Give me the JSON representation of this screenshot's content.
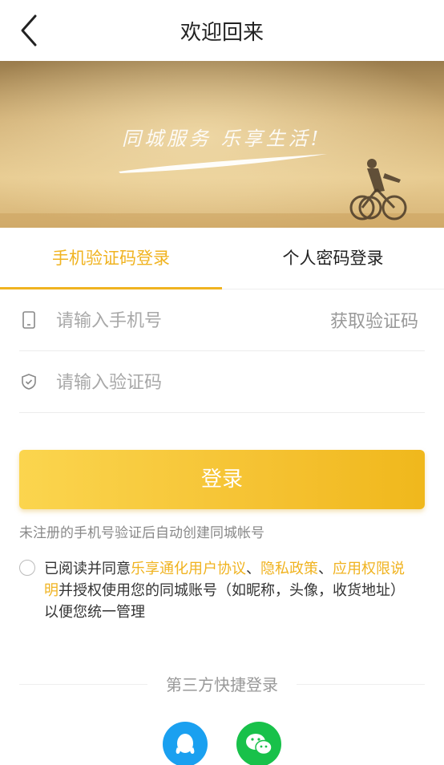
{
  "header": {
    "title": "欢迎回来",
    "back_icon": "chevron-left-icon"
  },
  "banner": {
    "slogan": "同城服务 乐享生活!",
    "background_color": "#d9b56a"
  },
  "tabs": [
    {
      "label": "手机验证码登录",
      "active": true
    },
    {
      "label": "个人密码登录",
      "active": false
    }
  ],
  "form": {
    "phone": {
      "placeholder": "请输入手机号",
      "value": "",
      "icon": "phone-icon"
    },
    "get_code_label": "获取验证码",
    "code": {
      "placeholder": "请输入验证码",
      "value": "",
      "icon": "shield-icon"
    }
  },
  "login_button": "登录",
  "note": "未注册的手机号验证后自动创建同城帐号",
  "agreement": {
    "prefix": "已阅读并同意",
    "link1": "乐享通化用户协议",
    "sep1": "、",
    "link2": "隐私政策",
    "sep2": "、",
    "link3": "应用权限说明",
    "suffix": "并授权使用您的同城账号（如昵称，头像，收货地址）以便您统一管理",
    "checked": false
  },
  "third_party": {
    "label": "第三方快捷登录",
    "providers": [
      "qq-icon",
      "wechat-icon"
    ]
  },
  "colors": {
    "accent": "#f0b320",
    "qq": "#1aa0f0",
    "wechat": "#18c14a"
  }
}
